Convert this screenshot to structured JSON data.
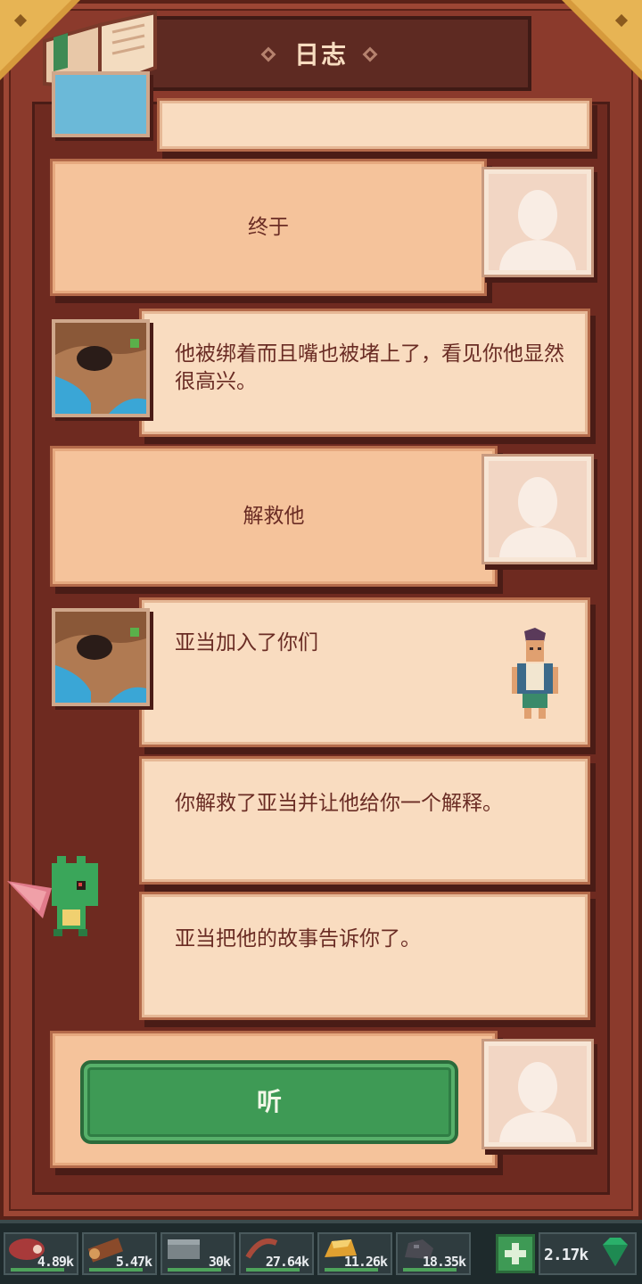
{
  "header": {
    "title": "日志"
  },
  "entries": [
    {
      "type": "choice",
      "text": "终于"
    },
    {
      "type": "narration",
      "text": "他被绑着而且嘴也被堵上了，看见你他显然很高兴。"
    },
    {
      "type": "choice",
      "text": "解救他"
    },
    {
      "type": "narration",
      "text": "亚当加入了你们"
    },
    {
      "type": "narration",
      "text": "你解救了亚当并让他给你一个解释。"
    },
    {
      "type": "narration",
      "text": "亚当把他的故事告诉你了。"
    }
  ],
  "action": {
    "label": "听"
  },
  "resources": [
    {
      "icon": "meat-icon",
      "value": "4.89k"
    },
    {
      "icon": "wood-log-icon",
      "value": "5.47k"
    },
    {
      "icon": "stone-icon",
      "value": "30k"
    },
    {
      "icon": "rope-icon",
      "value": "27.64k"
    },
    {
      "icon": "gold-ore-icon",
      "value": "11.26k"
    },
    {
      "icon": "coal-icon",
      "value": "18.35k"
    },
    {
      "icon": "gem-icon",
      "value": "2.17k"
    }
  ],
  "colors": {
    "frame": "#8b3a2c",
    "card": "#f9dcc0",
    "choice_card": "#f5c39b",
    "button": "#3e9a55",
    "text": "#6a2c24"
  }
}
